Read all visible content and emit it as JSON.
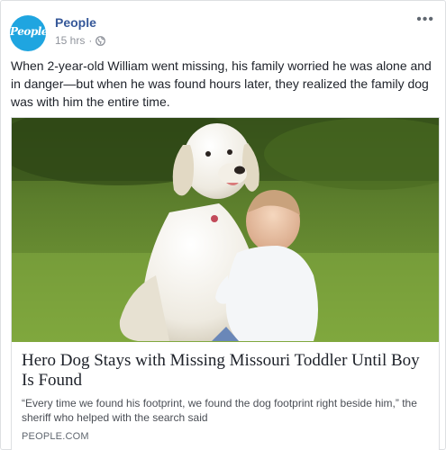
{
  "post": {
    "page_name": "People",
    "avatar_text": "People",
    "timestamp": "15 hrs",
    "separator": "·",
    "more_menu": "•••",
    "caption": "When 2-year-old William went missing, his family worried he was alone and in danger—but when he was found hours later, they realized the family dog was with him the entire time."
  },
  "link": {
    "title": "Hero Dog Stays with Missing Missouri Toddler Until Boy Is Found",
    "description": "“Every time we found his footprint, we found the dog footprint right beside him,” the sheriff who helped with the search said",
    "domain": "PEOPLE.COM"
  },
  "colors": {
    "page_name": "#365899",
    "avatar": "#1fa5e0",
    "meta": "#90949c"
  },
  "icons": {
    "privacy": "globe-icon",
    "menu": "more-options-icon"
  }
}
